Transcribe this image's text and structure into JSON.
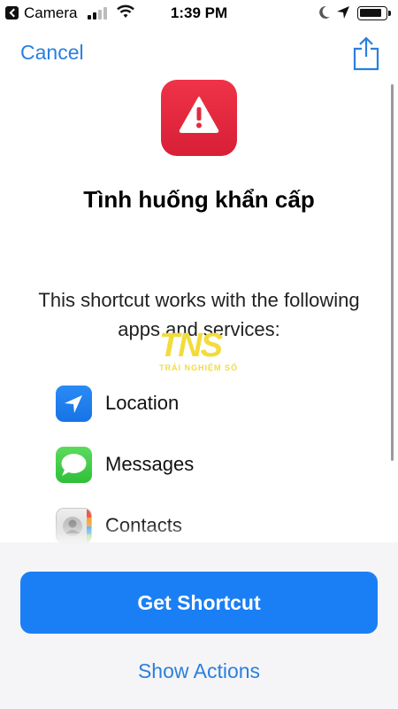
{
  "status_bar": {
    "back_app": "Camera",
    "time": "1:39 PM",
    "icons": [
      "back-arrow-icon",
      "signal-icon",
      "wifi-icon",
      "moon-icon",
      "location-arrow-icon",
      "battery-icon"
    ]
  },
  "nav": {
    "cancel_label": "Cancel",
    "share_icon": "share-icon"
  },
  "shortcut": {
    "icon": "warning-triangle-icon",
    "icon_color": "#e32a3f",
    "title": "Tình huống khẩn cấp"
  },
  "description": "This shortcut works with the following apps and services:",
  "watermark": {
    "main": "TNS",
    "sub": "TRẢI NGHIỆM SỐ"
  },
  "apps": [
    {
      "label": "Location",
      "icon": "location-app-icon",
      "color": "#1f82f0"
    },
    {
      "label": "Messages",
      "icon": "messages-app-icon",
      "color": "#3bc84a"
    },
    {
      "label": "Contacts",
      "icon": "contacts-app-icon",
      "color": "#d9d9d9"
    }
  ],
  "actions": {
    "primary_label": "Get Shortcut",
    "secondary_label": "Show Actions"
  },
  "colors": {
    "accent": "#2b7fde",
    "button": "#1a7ff5"
  }
}
